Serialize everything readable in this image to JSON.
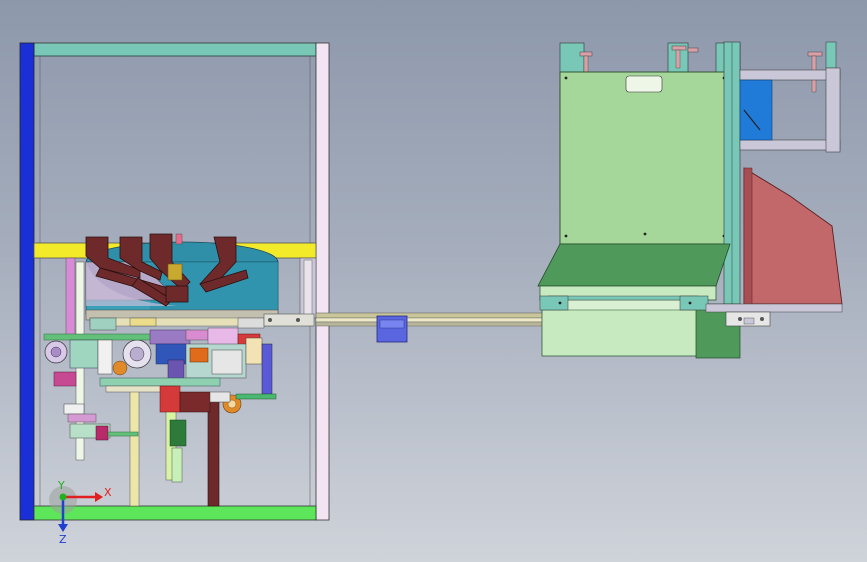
{
  "triad": {
    "x_label": "X",
    "y_label": "Y",
    "z_label": "Z",
    "x_color": "#e02020",
    "y_color": "#20b020",
    "z_color": "#2040d0"
  },
  "colors": {
    "background_top": "#8d98ab",
    "background_bottom": "#cfd3da",
    "frame_left_post": "#1a2fd6",
    "frame_top_beam": "#79c7b7",
    "frame_right_post": "#f2e4f3",
    "frame_base": "#5ee65a",
    "yellow_plate": "#f3ea2a",
    "hopper_maroon": "#6e2a2a",
    "bowl_teal": "#3aa0b8",
    "cabinet_green": "#a6d79a",
    "tray_green": "#4f9a5a",
    "chute_red": "#c2676a",
    "conveyor_tan": "#c9c79a"
  }
}
